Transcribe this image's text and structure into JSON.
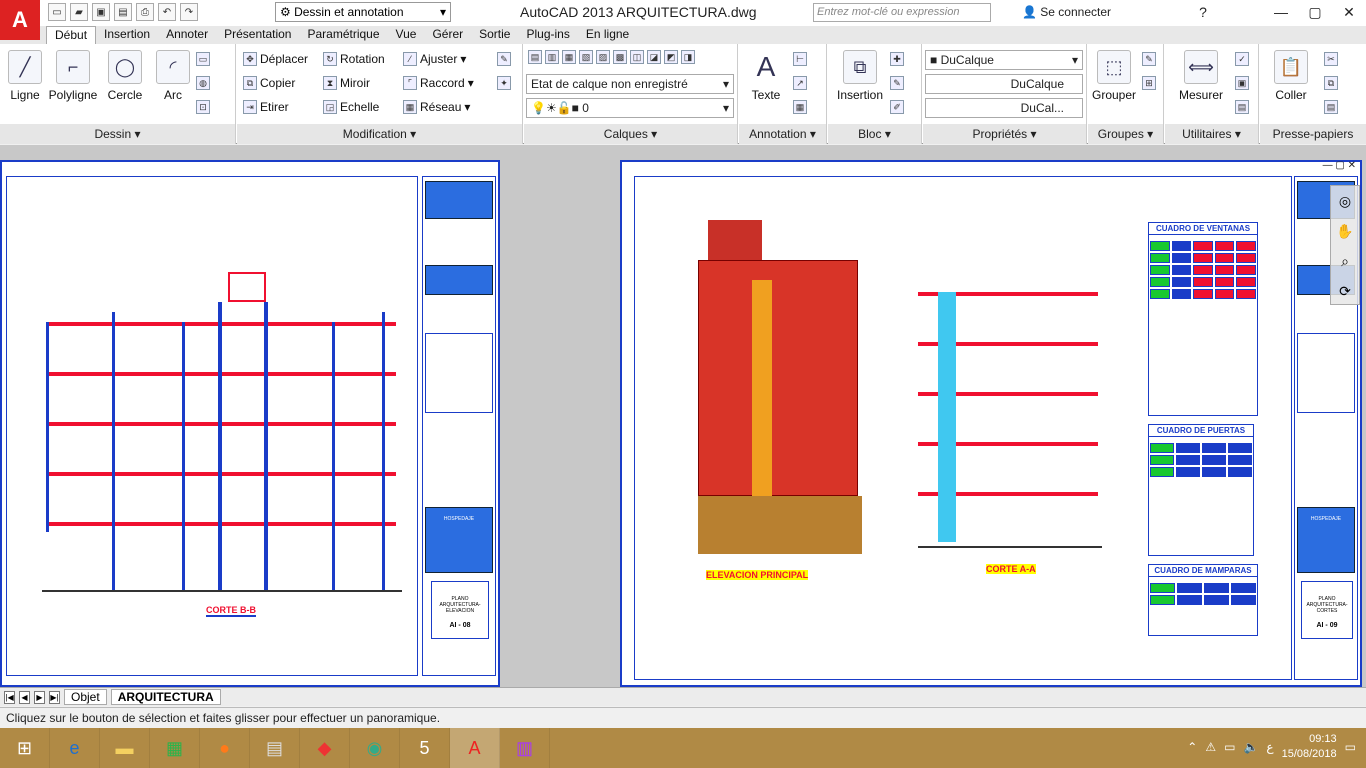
{
  "app": {
    "logo": "A",
    "title": "AutoCAD 2013    ARQUITECTURA.dwg"
  },
  "qat": {
    "icons": [
      "new-icon",
      "open-icon",
      "save-icon",
      "saveas-icon",
      "plot-icon",
      "undo-icon",
      "redo-icon"
    ],
    "workspace": "Dessin et annotation"
  },
  "search": {
    "placeholder": "Entrez mot-clé ou expression"
  },
  "account": {
    "connect": "Se connecter"
  },
  "tabs": [
    "Début",
    "Insertion",
    "Annoter",
    "Présentation",
    "Paramétrique",
    "Vue",
    "Gérer",
    "Sortie",
    "Plug-ins",
    "En ligne"
  ],
  "panels": {
    "dessin": {
      "title": "Dessin",
      "tools": [
        "Ligne",
        "Polyligne",
        "Cercle",
        "Arc"
      ]
    },
    "modification": {
      "title": "Modification",
      "tools": [
        "Déplacer",
        "Rotation",
        "Ajuster",
        "Copier",
        "Miroir",
        "Raccord",
        "Etirer",
        "Echelle",
        "Réseau"
      ]
    },
    "calques": {
      "title": "Calques",
      "layer_state": "Etat de calque non enregistré",
      "current_layer": "0"
    },
    "annotation": {
      "title": "Annotation",
      "tool": "Texte"
    },
    "bloc": {
      "title": "Bloc",
      "tool": "Insertion"
    },
    "proprietes": {
      "title": "Propriétés",
      "color": "DuCalque",
      "linetype": "DuCalque",
      "lineweight": "DuCal..."
    },
    "groupes": {
      "title": "Groupes",
      "tool": "Grouper"
    },
    "utilitaires": {
      "title": "Utilitaires",
      "tool": "Mesurer"
    },
    "presse": {
      "title": "Presse-papiers",
      "tool": "Coller"
    }
  },
  "sheets": {
    "left": {
      "caption": "CORTE B-B",
      "tb_title": "PLANO ARQUITECTURA- ELEVACION",
      "tb_code": "AI - 08",
      "tb_small": "HOSPEDAJE"
    },
    "right": {
      "caption_elev": "ELEVACION PRINCIPAL",
      "caption_corte": "CORTE A-A",
      "tb_title": "PLANO ARQUITECTURA- CORTES",
      "tb_code": "AI - 09",
      "tb_small": "HOSPEDAJE",
      "schedules": [
        "CUADRO DE VENTANAS",
        "CUADRO DE PUERTAS",
        "CUADRO DE MAMPARAS"
      ],
      "sign_text": "HOSPEDAJE HOSPEDAJE"
    }
  },
  "layout_tabs": [
    "Objet",
    "ARQUITECTURA"
  ],
  "command": {
    "text": "Cliquez sur le bouton de sélection et faites glisser pour effectuer un panoramique."
  },
  "taskbar": {
    "apps": [
      "windows-icon",
      "edge-icon",
      "explorer-icon",
      "store-icon",
      "firefox-icon",
      "calculator-icon",
      "app-icon",
      "chrome-icon",
      "5iste-icon",
      "autocad-icon",
      "winrar-icon"
    ]
  },
  "clock": {
    "time": "09:13",
    "date": "15/08/2018"
  },
  "colors": {
    "accent": "#1a3cc8",
    "red": "#f01030",
    "green": "#19c830",
    "taskbar": "#b08a45"
  }
}
